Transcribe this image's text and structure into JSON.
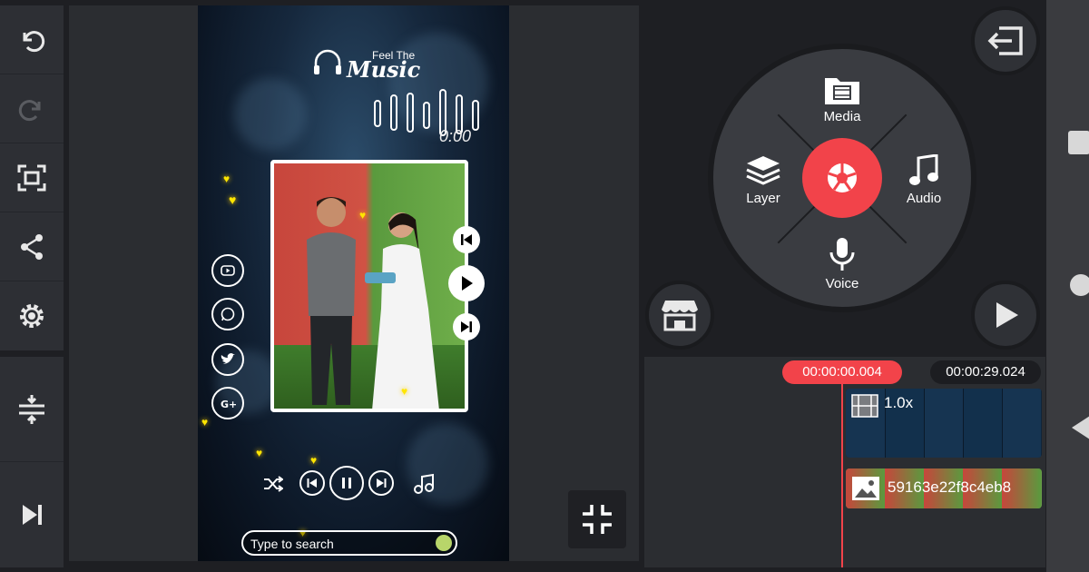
{
  "left_toolbar": {
    "buttons": [
      {
        "name": "undo",
        "icon": "undo-icon"
      },
      {
        "name": "redo",
        "icon": "redo-icon"
      },
      {
        "name": "fullscreen",
        "icon": "fullscreen-icon"
      },
      {
        "name": "share",
        "icon": "share-icon"
      },
      {
        "name": "settings",
        "icon": "gear-icon"
      },
      {
        "name": "timeline-adjust",
        "icon": "expand-vertical-icon"
      },
      {
        "name": "jump-to-end",
        "icon": "skip-to-end-icon"
      }
    ]
  },
  "preview": {
    "feel_the": "Feel The",
    "music_title": "Music",
    "time": "0:00",
    "search_placeholder": "Type to search",
    "collapse_icon": "collapse-icon"
  },
  "wheel": {
    "media_label": "Media",
    "layer_label": "Layer",
    "audio_label": "Audio",
    "voice_label": "Voice",
    "record_icon": "camera-shutter-icon",
    "accent": "#f2434a"
  },
  "timeline": {
    "current_time": "00:00:00.004",
    "total_time": "00:00:29.024",
    "layer_speed": "1.0x",
    "video_clip_name": "59163e22f8c4eb8"
  },
  "buttons": {
    "exit_icon": "exit-icon",
    "store_icon": "store-icon",
    "play_icon": "play-icon"
  }
}
